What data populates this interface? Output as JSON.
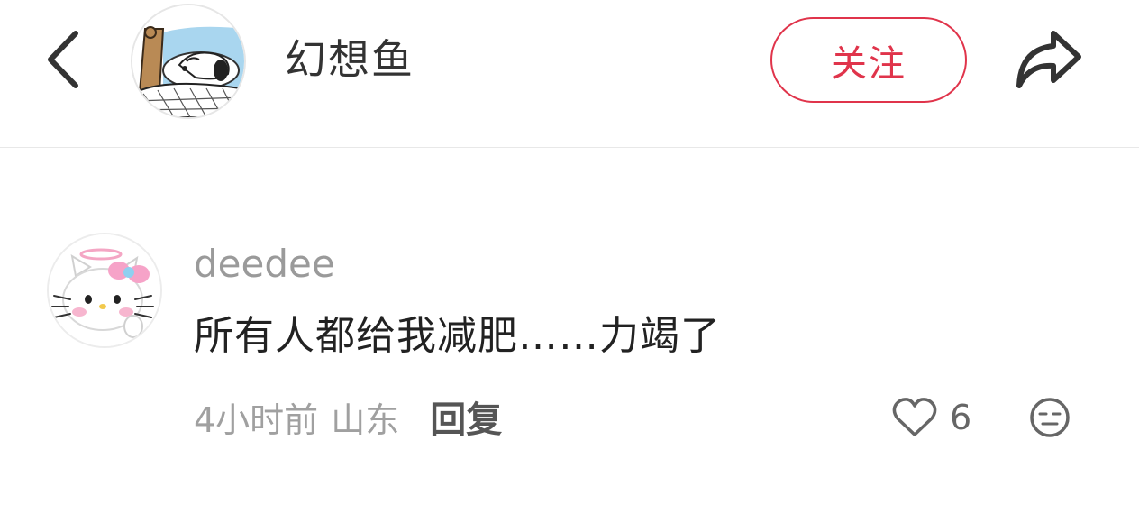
{
  "header": {
    "back_icon": "chevron-left-icon",
    "author_name": "幻想鱼",
    "follow_label": "关注",
    "share_icon": "share-arrow-icon"
  },
  "comment": {
    "username": "deedee",
    "text": "所有人都给我减肥……力竭了",
    "time": "4小时前",
    "location": "山东",
    "reply_label": "回复",
    "like_icon": "heart-outline-icon",
    "like_count": "6",
    "dislike_icon": "neutral-face-icon"
  },
  "colors": {
    "accent": "#e0344b",
    "secondary_text": "#9a9a9a",
    "divider": "#e8e8e8"
  }
}
